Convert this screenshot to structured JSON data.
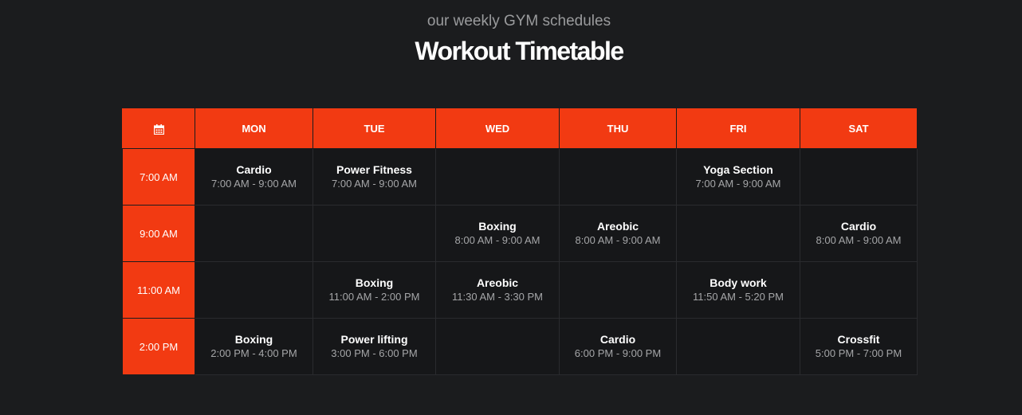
{
  "header": {
    "subtitle": "our weekly GYM schedules",
    "title": "Workout Timetable"
  },
  "colors": {
    "accent": "#f23a12",
    "background": "#1b1c1e",
    "cell": "#161719"
  },
  "table": {
    "corner_icon": "calendar-icon",
    "days": [
      "MON",
      "TUE",
      "WED",
      "THU",
      "FRI",
      "SAT"
    ],
    "rows": [
      {
        "time": "7:00 AM",
        "cells": [
          {
            "name": "Cardio",
            "time": "7:00 AM - 9:00 AM"
          },
          {
            "name": "Power Fitness",
            "time": "7:00 AM - 9:00 AM"
          },
          {
            "name": "",
            "time": ""
          },
          {
            "name": "",
            "time": ""
          },
          {
            "name": "Yoga Section",
            "time": "7:00 AM - 9:00 AM"
          },
          {
            "name": "",
            "time": ""
          }
        ]
      },
      {
        "time": "9:00 AM",
        "cells": [
          {
            "name": "",
            "time": ""
          },
          {
            "name": "",
            "time": ""
          },
          {
            "name": "Boxing",
            "time": "8:00 AM - 9:00 AM"
          },
          {
            "name": "Areobic",
            "time": "8:00 AM - 9:00 AM"
          },
          {
            "name": "",
            "time": ""
          },
          {
            "name": "Cardio",
            "time": "8:00 AM - 9:00 AM"
          }
        ]
      },
      {
        "time": "11:00 AM",
        "cells": [
          {
            "name": "",
            "time": ""
          },
          {
            "name": "Boxing",
            "time": "11:00 AM - 2:00 PM"
          },
          {
            "name": "Areobic",
            "time": "11:30 AM - 3:30 PM"
          },
          {
            "name": "",
            "time": ""
          },
          {
            "name": "Body work",
            "time": "11:50 AM - 5:20 PM"
          },
          {
            "name": "",
            "time": ""
          }
        ]
      },
      {
        "time": "2:00 PM",
        "cells": [
          {
            "name": "Boxing",
            "time": "2:00 PM - 4:00 PM"
          },
          {
            "name": "Power lifting",
            "time": "3:00 PM - 6:00 PM"
          },
          {
            "name": "",
            "time": ""
          },
          {
            "name": "Cardio",
            "time": "6:00 PM - 9:00 PM"
          },
          {
            "name": "",
            "time": ""
          },
          {
            "name": "Crossfit",
            "time": "5:00 PM - 7:00 PM"
          }
        ]
      }
    ]
  }
}
